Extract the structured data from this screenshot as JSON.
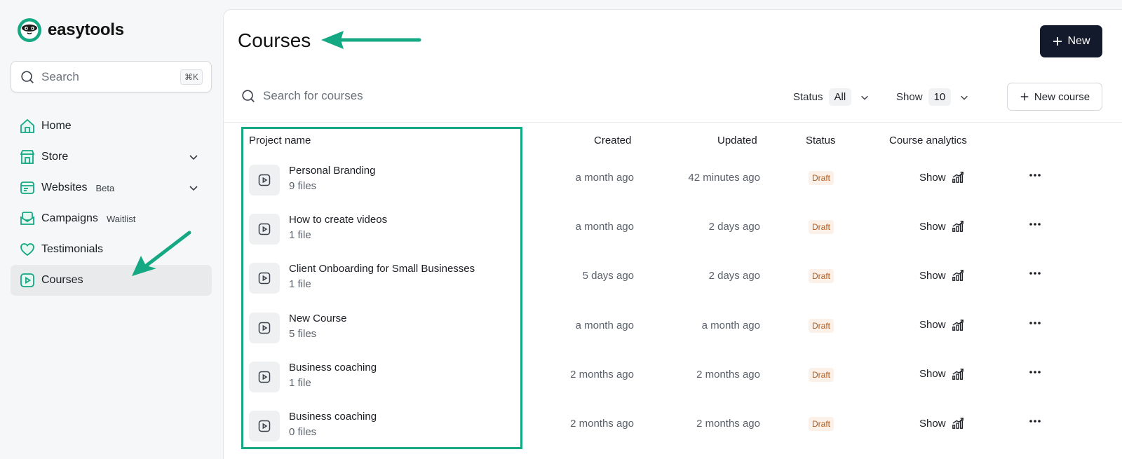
{
  "brand": {
    "name": "easytools"
  },
  "sidebar": {
    "search_placeholder": "Search",
    "search_shortcut": "⌘K",
    "items": [
      {
        "label": "Home",
        "icon": "home-icon",
        "badge": "",
        "expandable": false,
        "active": false
      },
      {
        "label": "Store",
        "icon": "store-icon",
        "badge": "",
        "expandable": true,
        "active": false
      },
      {
        "label": "Websites",
        "icon": "website-icon",
        "badge": "Beta",
        "expandable": true,
        "active": false
      },
      {
        "label": "Campaigns",
        "icon": "mail-icon",
        "badge": "Waitlist",
        "expandable": false,
        "active": false
      },
      {
        "label": "Testimonials",
        "icon": "heart-icon",
        "badge": "",
        "expandable": false,
        "active": false
      },
      {
        "label": "Courses",
        "icon": "play-icon",
        "badge": "",
        "expandable": false,
        "active": true
      }
    ]
  },
  "main": {
    "title": "Courses",
    "new_button": "New",
    "search_placeholder": "Search for courses",
    "status_label": "Status",
    "status_value": "All",
    "show_label": "Show",
    "show_value": "10",
    "new_course_button": "New course"
  },
  "table": {
    "columns": {
      "project": "Project name",
      "created": "Created",
      "updated": "Updated",
      "status": "Status",
      "analytics": "Course analytics"
    },
    "rows": [
      {
        "name": "Personal Branding",
        "files": "9 files",
        "created": "a month ago",
        "updated": "42 minutes ago",
        "status": "Draft",
        "analytics": "Show"
      },
      {
        "name": "How to create videos",
        "files": "1 file",
        "created": "a month ago",
        "updated": "2 days ago",
        "status": "Draft",
        "analytics": "Show"
      },
      {
        "name": "Client Onboarding for Small Businesses",
        "files": "1 file",
        "created": "5 days ago",
        "updated": "2 days ago",
        "status": "Draft",
        "analytics": "Show"
      },
      {
        "name": "New Course",
        "files": "5 files",
        "created": "a month ago",
        "updated": "a month ago",
        "status": "Draft",
        "analytics": "Show"
      },
      {
        "name": "Business coaching",
        "files": "1 file",
        "created": "2 months ago",
        "updated": "2 months ago",
        "status": "Draft",
        "analytics": "Show"
      },
      {
        "name": "Business coaching",
        "files": "0 files",
        "created": "2 months ago",
        "updated": "2 months ago",
        "status": "Draft",
        "analytics": "Show"
      }
    ]
  },
  "colors": {
    "accent": "#14a883",
    "primary_button": "#131a2b",
    "draft_text": "#b35a1b",
    "draft_bg": "#fbf1e8",
    "active_nav_bg": "#e8eaec"
  }
}
